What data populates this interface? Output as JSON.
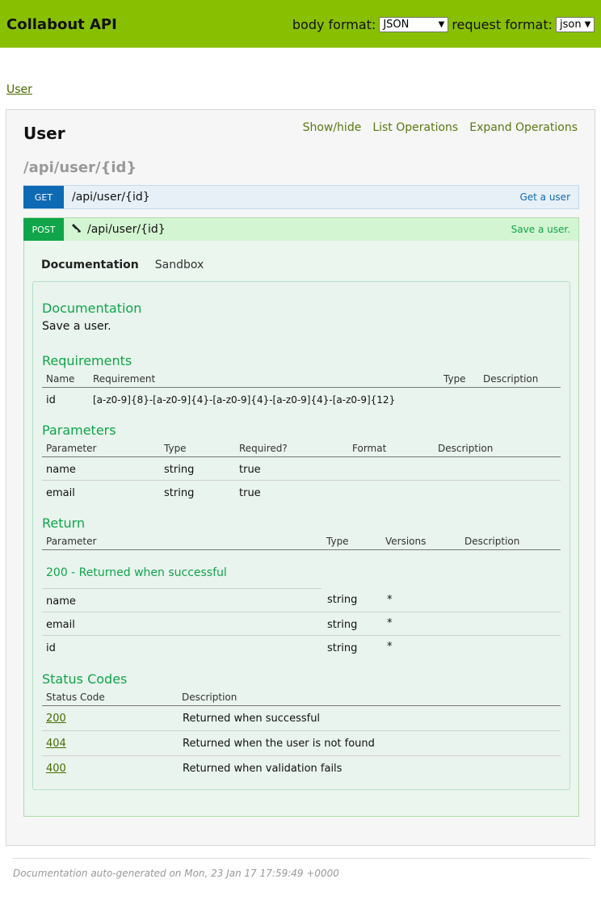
{
  "header": {
    "title": "Collabout API",
    "body_format_label": "body format:",
    "body_format_value": "JSON",
    "request_format_label": "request format:",
    "request_format_value": "json"
  },
  "breadcrumb": {
    "label": "User"
  },
  "resource": {
    "title": "User",
    "links": {
      "show_hide": "Show/hide",
      "list_ops": "List Operations",
      "expand_ops": "Expand Operations"
    },
    "path": "/api/user/{id}"
  },
  "operations": {
    "get": {
      "method": "GET",
      "path": "/api/user/{id}",
      "summary": "Get a user"
    },
    "post": {
      "method": "POST",
      "path": "/api/user/{id}",
      "summary": "Save a user."
    }
  },
  "tabs": {
    "documentation": "Documentation",
    "sandbox": "Sandbox"
  },
  "doc": {
    "heading": "Documentation",
    "text": "Save a user.",
    "requirements": {
      "heading": "Requirements",
      "headers": {
        "name": "Name",
        "requirement": "Requirement",
        "type": "Type",
        "description": "Description"
      },
      "rows": [
        {
          "name": "id",
          "requirement": "[a-z0-9]{8}-[a-z0-9]{4}-[a-z0-9]{4}-[a-z0-9]{4}-[a-z0-9]{12}",
          "type": "",
          "description": ""
        }
      ]
    },
    "parameters": {
      "heading": "Parameters",
      "headers": {
        "parameter": "Parameter",
        "type": "Type",
        "required": "Required?",
        "format": "Format",
        "description": "Description"
      },
      "rows": [
        {
          "parameter": "name",
          "type": "string",
          "required": "true"
        },
        {
          "parameter": "email",
          "type": "string",
          "required": "true"
        }
      ]
    },
    "return": {
      "heading": "Return",
      "headers": {
        "parameter": "Parameter",
        "type": "Type",
        "versions": "Versions",
        "description": "Description"
      },
      "group": "200 - Returned when successful",
      "rows": [
        {
          "parameter": "name",
          "type": "string",
          "versions": "*"
        },
        {
          "parameter": "email",
          "type": "string",
          "versions": "*"
        },
        {
          "parameter": "id",
          "type": "string",
          "versions": "*"
        }
      ]
    },
    "status_codes": {
      "heading": "Status Codes",
      "headers": {
        "code": "Status Code",
        "description": "Description"
      },
      "rows": [
        {
          "code": "200",
          "description": "Returned when successful"
        },
        {
          "code": "404",
          "description": "Returned when the user is not found"
        },
        {
          "code": "400",
          "description": "Returned when validation fails"
        }
      ]
    }
  },
  "footer": {
    "text": "Documentation auto-generated on Mon, 23 Jan 17 17:59:49 +0000"
  },
  "icons": {
    "lock": "lock-icon",
    "caret": "chevron-down-icon"
  },
  "colors": {
    "header": "#88bf00",
    "get": "#0f6ab4",
    "post": "#10a54a"
  }
}
